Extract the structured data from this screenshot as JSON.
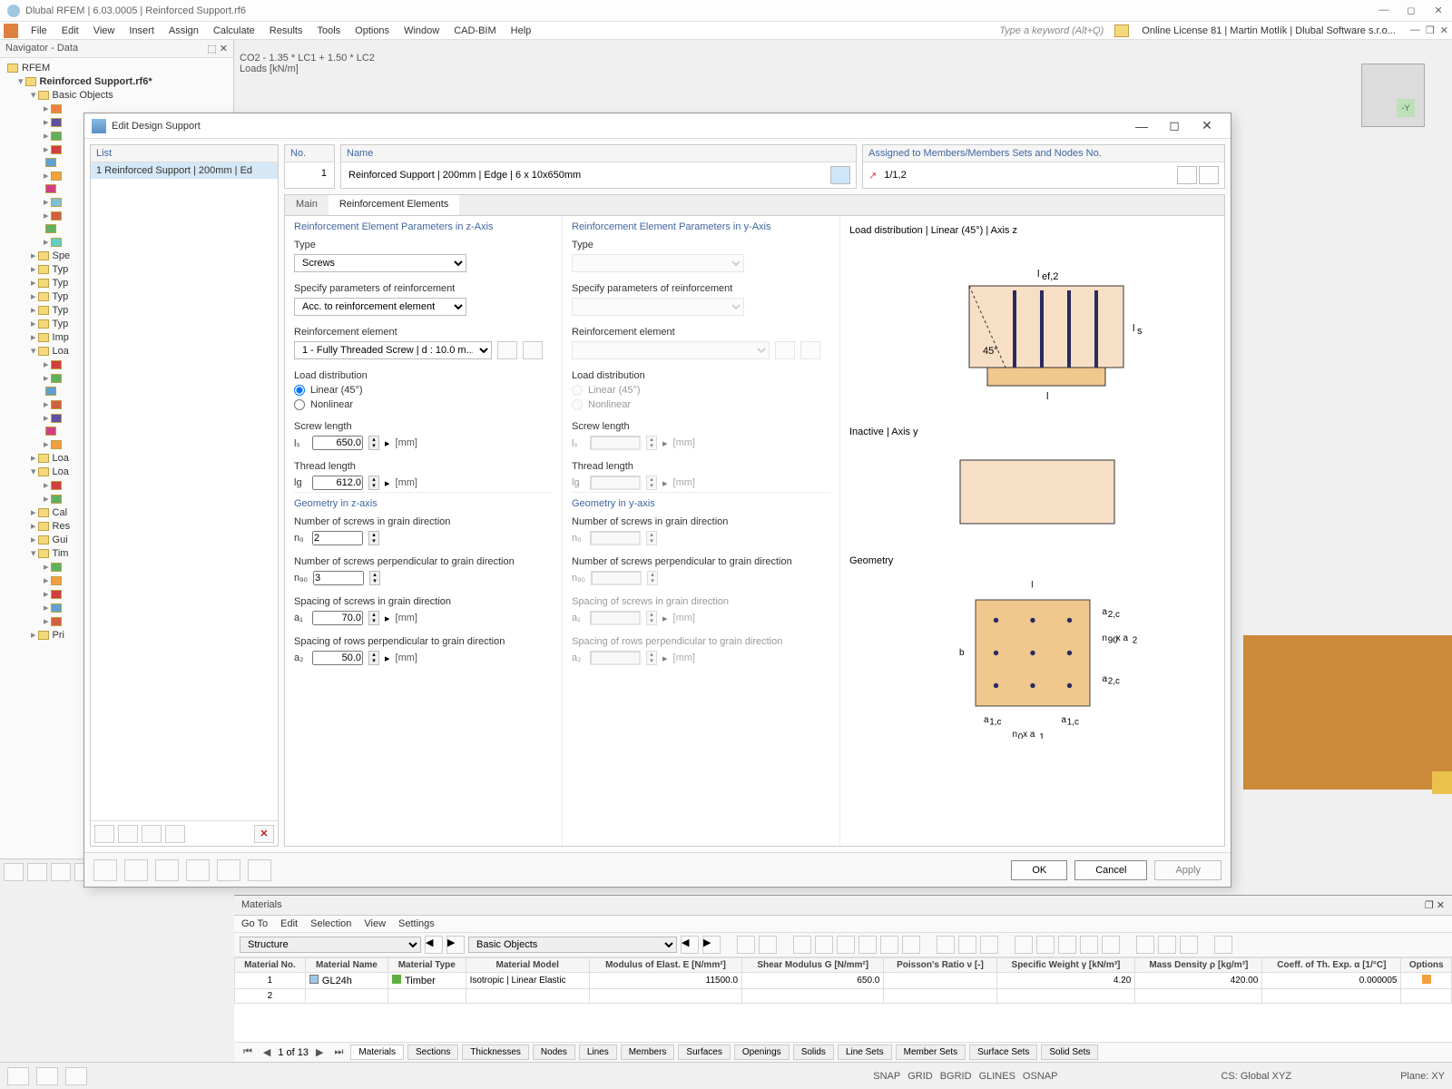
{
  "app": {
    "title": "Dlubal RFEM | 6.03.0005 | Reinforced Support.rf6",
    "license": "Online License 81 | Martin Motlík | Dlubal Software s.r.o..."
  },
  "menu": [
    "File",
    "Edit",
    "View",
    "Insert",
    "Assign",
    "Calculate",
    "Results",
    "Tools",
    "Options",
    "Window",
    "CAD-BIM",
    "Help"
  ],
  "searchHint": "Type a keyword (Alt+Q)",
  "navigator": {
    "title": "Navigator - Data",
    "root": "RFEM",
    "file": "Reinforced Support.rf6*",
    "basic": "Basic Objects",
    "nodes": [
      "Spe",
      "Typ",
      "Typ",
      "Typ",
      "Typ",
      "Typ",
      "Imp",
      "Loa",
      "Loa",
      "Loa",
      "Cal",
      "Res",
      "Gui",
      "Tim",
      "Pri"
    ]
  },
  "viewport": {
    "combo": "CO2 - 1.35 * LC1 + 1.50 * LC2",
    "loads": "Loads [kN/m]"
  },
  "dialog": {
    "title": "Edit Design Support",
    "list": {
      "head": "List",
      "row": "1  Reinforced Support | 200mm | Ed"
    },
    "no": {
      "label": "No.",
      "val": "1"
    },
    "name": {
      "label": "Name",
      "val": "Reinforced Support | 200mm | Edge | 6 x 10x650mm"
    },
    "assigned": {
      "label": "Assigned to Members/Members Sets and Nodes No.",
      "val": "1/1,2"
    },
    "tabs": {
      "main": "Main",
      "reinf": "Reinforcement Elements"
    },
    "z": {
      "head": "Reinforcement Element Parameters in z-Axis",
      "type": "Type",
      "typeVal": "Screws",
      "spec": "Specify parameters of reinforcement",
      "specVal": "Acc. to reinforcement element",
      "elem": "Reinforcement element",
      "elemVal": "1 - Fully Threaded Screw | d : 10.0 m...",
      "loadDist": "Load distribution",
      "linear": "Linear (45°)",
      "nonlinear": "Nonlinear",
      "screwLen": "Screw length",
      "screwLenSym": "lₛ",
      "screwLenVal": "650.0",
      "threadLen": "Thread length",
      "threadLenSym": "lg",
      "threadLenVal": "612.0",
      "geomHead": "Geometry in z-axis",
      "n0lbl": "Number of screws in grain direction",
      "n0sym": "n₀",
      "n0val": "2",
      "n90lbl": "Number of screws perpendicular to grain direction",
      "n90sym": "n₉₀",
      "n90val": "3",
      "a1lbl": "Spacing of screws in grain direction",
      "a1sym": "a₁",
      "a1val": "70.0",
      "a2lbl": "Spacing of rows perpendicular to grain direction",
      "a2sym": "a₂",
      "a2val": "50.0",
      "mm": "[mm]"
    },
    "y": {
      "head": "Reinforcement Element Parameters in y-Axis",
      "type": "Type",
      "spec": "Specify parameters of reinforcement",
      "elem": "Reinforcement element",
      "loadDist": "Load distribution",
      "linear": "Linear (45°)",
      "nonlinear": "Nonlinear",
      "screwLen": "Screw length",
      "screwLenSym": "lₛ",
      "threadLen": "Thread length",
      "threadLenSym": "lg",
      "geomHead": "Geometry in y-axis",
      "n0lbl": "Number of screws in grain direction",
      "n0sym": "n₀",
      "n90lbl": "Number of screws perpendicular to grain direction",
      "n90sym": "n₉₀",
      "a1lbl": "Spacing of screws in grain direction",
      "a1sym": "a₁",
      "a2lbl": "Spacing of rows perpendicular to grain direction",
      "a2sym": "a₂",
      "mm": "[mm]"
    },
    "diag": {
      "d1": "Load distribution | Linear (45°) | Axis z",
      "d2": "Inactive | Axis y",
      "d3": "Geometry"
    },
    "buttons": {
      "ok": "OK",
      "cancel": "Cancel",
      "apply": "Apply"
    }
  },
  "materials": {
    "title": "Materials",
    "menu": [
      "Go To",
      "Edit",
      "Selection",
      "View",
      "Settings"
    ],
    "combo1": "Structure",
    "combo2": "Basic Objects",
    "headers": [
      "Material No.",
      "Material Name",
      "Material Type",
      "Material Model",
      "Modulus of Elast. E [N/mm²]",
      "Shear Modulus G [N/mm²]",
      "Poisson's Ratio ν [-]",
      "Specific Weight γ [kN/m³]",
      "Mass Density ρ [kg/m³]",
      "Coeff. of Th. Exp. α [1/°C]",
      "Options"
    ],
    "row": {
      "no": "1",
      "name": "GL24h",
      "type": "Timber",
      "model": "Isotropic | Linear Elastic",
      "E": "11500.0",
      "G": "650.0",
      "nu": "",
      "gamma": "4.20",
      "rho": "420.00",
      "alpha": "0.000005"
    },
    "page": "1 of 13",
    "tabs": [
      "Materials",
      "Sections",
      "Thicknesses",
      "Nodes",
      "Lines",
      "Members",
      "Surfaces",
      "Openings",
      "Solids",
      "Line Sets",
      "Member Sets",
      "Surface Sets",
      "Solid Sets"
    ]
  },
  "status": {
    "snap": [
      "SNAP",
      "GRID",
      "BGRID",
      "GLINES",
      "OSNAP"
    ],
    "cs": "CS: Global XYZ",
    "plane": "Plane: XY"
  }
}
